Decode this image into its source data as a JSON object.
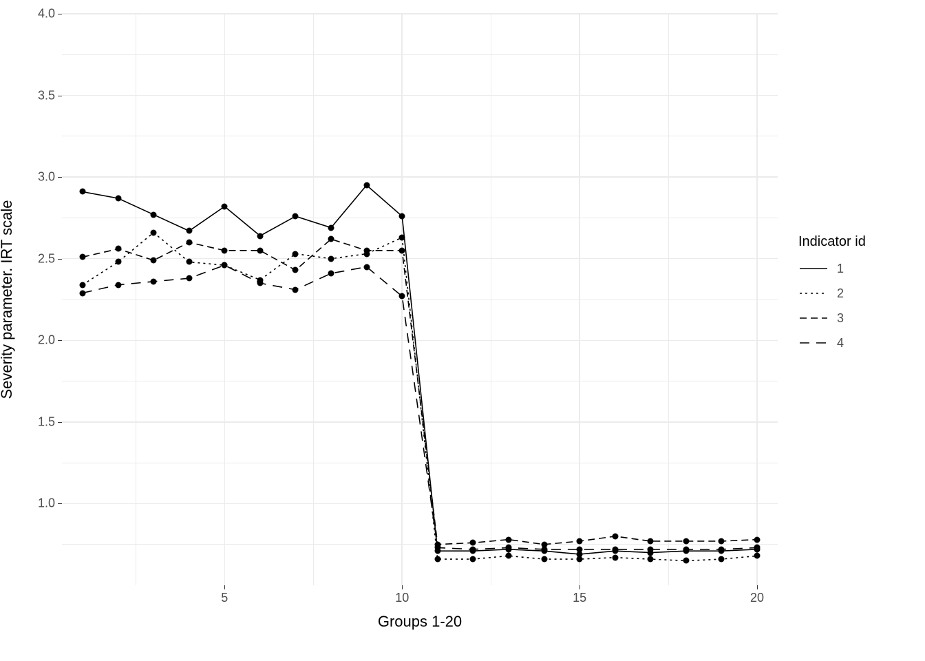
{
  "chart_data": {
    "type": "line",
    "xlabel": "Groups 1-20",
    "ylabel": "Severity parameter. IRT scale",
    "xlim": [
      1,
      20
    ],
    "ylim": [
      0.5,
      4.0
    ],
    "x_ticks": [
      5,
      10,
      15,
      20
    ],
    "y_ticks": [
      1.0,
      1.5,
      2.0,
      2.5,
      3.0,
      3.5,
      4.0
    ],
    "x_minor": [
      2.5,
      7.5,
      12.5,
      17.5
    ],
    "y_minor": [
      0.75,
      1.25,
      1.75,
      2.25,
      2.75,
      3.25,
      3.75
    ],
    "x": [
      1,
      2,
      3,
      4,
      5,
      6,
      7,
      8,
      9,
      10,
      11,
      12,
      13,
      14,
      15,
      16,
      17,
      18,
      19,
      20
    ],
    "series": [
      {
        "name": "1",
        "linetype": "solid",
        "values": [
          2.91,
          2.87,
          2.77,
          2.67,
          2.82,
          2.64,
          2.76,
          2.69,
          2.95,
          2.76,
          0.71,
          0.71,
          0.72,
          0.71,
          0.69,
          0.71,
          0.7,
          0.71,
          0.71,
          0.72
        ]
      },
      {
        "name": "2",
        "linetype": "dotted",
        "values": [
          2.34,
          2.48,
          2.66,
          2.48,
          2.46,
          2.37,
          2.53,
          2.5,
          2.53,
          2.63,
          0.66,
          0.66,
          0.68,
          0.66,
          0.66,
          0.67,
          0.66,
          0.65,
          0.66,
          0.68
        ]
      },
      {
        "name": "3",
        "linetype": "shortdash",
        "values": [
          2.51,
          2.56,
          2.49,
          2.6,
          2.55,
          2.55,
          2.43,
          2.62,
          2.55,
          2.55,
          0.75,
          0.76,
          0.78,
          0.75,
          0.77,
          0.8,
          0.77,
          0.77,
          0.77,
          0.78
        ]
      },
      {
        "name": "4",
        "linetype": "longdash",
        "values": [
          2.29,
          2.34,
          2.36,
          2.38,
          2.46,
          2.35,
          2.31,
          2.41,
          2.45,
          2.27,
          0.73,
          0.72,
          0.73,
          0.72,
          0.72,
          0.72,
          0.72,
          0.72,
          0.72,
          0.73
        ]
      }
    ],
    "legend_title": "Indicator id",
    "grid": true
  }
}
